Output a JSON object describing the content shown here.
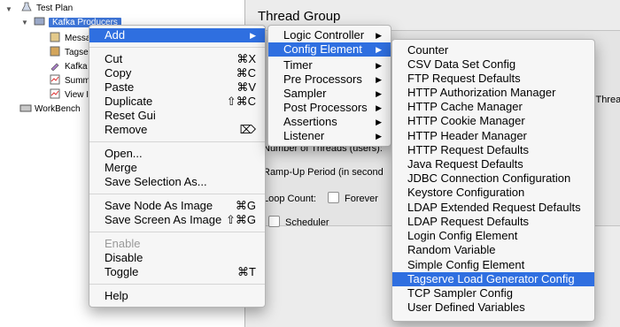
{
  "tree": {
    "test_plan": "Test Plan",
    "kafka_producers": "Kafka Producers",
    "items": [
      "Messa",
      "Tagse",
      "Kafka",
      "Summ",
      "View I"
    ],
    "workbench": "WorkBench"
  },
  "panel": {
    "title": "Thread Group",
    "hidden_label": "Next Thread",
    "num_threads": "Number of Threads (users):",
    "rampup": "Ramp-Up Period (in second",
    "loop_count": "Loop Count:",
    "forever": "Forever",
    "scheduler": "Scheduler"
  },
  "context_menu": {
    "add": "Add",
    "cut": "Cut",
    "cut_sc": "⌘X",
    "copy": "Copy",
    "copy_sc": "⌘C",
    "paste": "Paste",
    "paste_sc": "⌘V",
    "duplicate": "Duplicate",
    "duplicate_sc": "⇧⌘C",
    "reset_gui": "Reset Gui",
    "remove": "Remove",
    "remove_sc": "⌦",
    "open": "Open...",
    "merge": "Merge",
    "save_selection": "Save Selection As...",
    "save_node_image": "Save Node As Image",
    "save_node_image_sc": "⌘G",
    "save_screen_image": "Save Screen As Image",
    "save_screen_image_sc": "⇧⌘G",
    "enable": "Enable",
    "disable": "Disable",
    "toggle": "Toggle",
    "toggle_sc": "⌘T",
    "help": "Help"
  },
  "add_menu": {
    "items": [
      "Logic Controller",
      "Config Element",
      "Timer",
      "Pre Processors",
      "Sampler",
      "Post Processors",
      "Assertions",
      "Listener"
    ]
  },
  "config_menu": {
    "items": [
      "Counter",
      "CSV Data Set Config",
      "FTP Request Defaults",
      "HTTP Authorization Manager",
      "HTTP Cache Manager",
      "HTTP Cookie Manager",
      "HTTP Header Manager",
      "HTTP Request Defaults",
      "Java Request Defaults",
      "JDBC Connection Configuration",
      "Keystore Configuration",
      "LDAP Extended Request Defaults",
      "LDAP Request Defaults",
      "Login Config Element",
      "Random Variable",
      "Simple Config Element",
      "Tagserve Load Generator Config",
      "TCP Sampler Config",
      "User Defined Variables"
    ]
  },
  "colors": {
    "highlight": "#2f6fe0",
    "tree_selection": "#3d74d6"
  }
}
